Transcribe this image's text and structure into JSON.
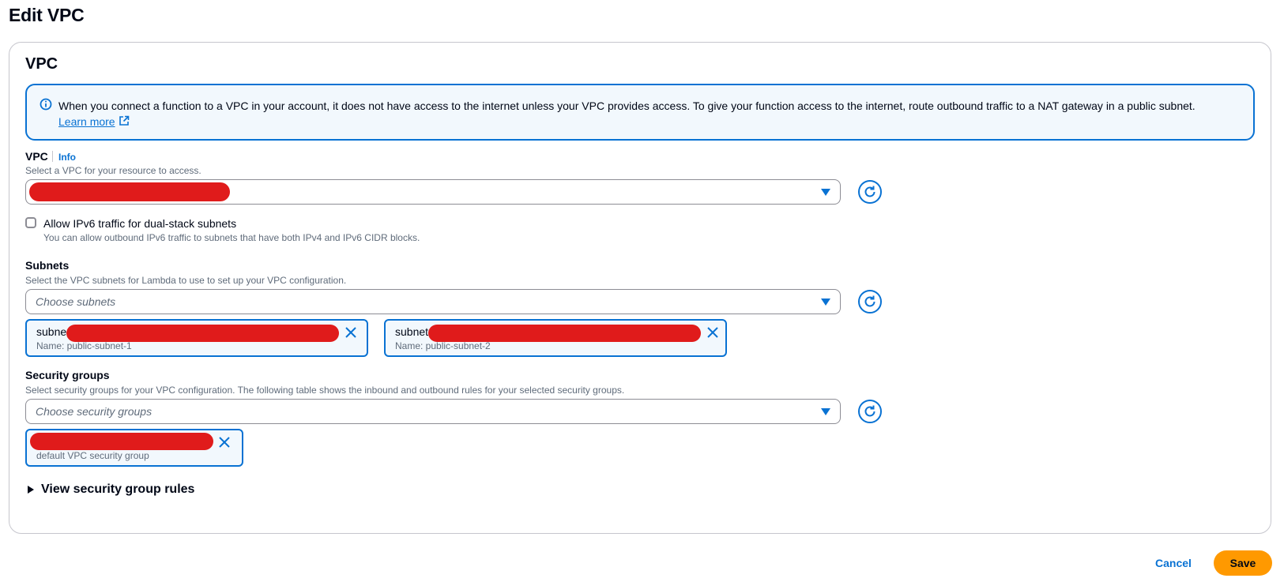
{
  "page": {
    "title": "Edit VPC"
  },
  "panel": {
    "title": "VPC"
  },
  "alert": {
    "text": "When you connect a function to a VPC in your account, it does not have access to the internet unless your VPC provides access. To give your function access to the internet, route outbound traffic to a NAT gateway in a public subnet.",
    "link": "Learn more",
    "icon": "info-icon",
    "link_icon": "external-link-icon"
  },
  "vpc": {
    "label": "VPC",
    "info": "Info",
    "description": "Select a VPC for your resource to access."
  },
  "ipv6": {
    "label": "Allow IPv6 traffic for dual-stack subnets",
    "description": "You can allow outbound IPv6 traffic to subnets that have both IPv4 and IPv6 CIDR blocks.",
    "checked": false
  },
  "subnets": {
    "label": "Subnets",
    "description": "Select the VPC subnets for Lambda to use to set up your VPC configuration.",
    "placeholder": "Choose subnets",
    "tokens": [
      {
        "title": "subne",
        "subtitle": "Name: public-subnet-1"
      },
      {
        "title": "subnet",
        "subtitle": "Name: public-subnet-2"
      }
    ]
  },
  "security_groups": {
    "label": "Security groups",
    "description": "Select security groups for your VPC configuration. The following table shows the inbound and outbound rules for your selected security groups.",
    "placeholder": "Choose security groups",
    "tokens": [
      {
        "subtitle": "default VPC security group"
      }
    ]
  },
  "rules": {
    "label": "View security group rules"
  },
  "footer": {
    "cancel": "Cancel",
    "save": "Save"
  },
  "colors": {
    "accent": "#0972d3",
    "primary_button": "#ff9900",
    "redaction": "#e01b1b"
  }
}
